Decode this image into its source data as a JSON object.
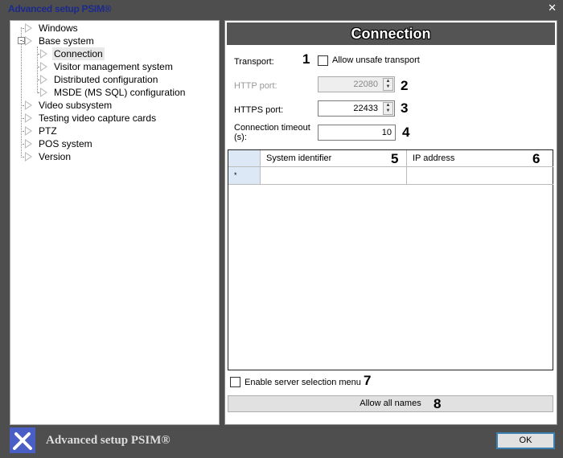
{
  "window": {
    "title": "Advanced setup PSIM®",
    "close": "✕"
  },
  "tree": {
    "items": [
      {
        "label": "Windows",
        "level": 0
      },
      {
        "label": "Base system",
        "level": 0,
        "expanded": true
      },
      {
        "label": "Connection",
        "level": 1,
        "selected": true
      },
      {
        "label": "Visitor management system",
        "level": 1
      },
      {
        "label": "Distributed configuration",
        "level": 1
      },
      {
        "label": "MSDE (MS SQL) configuration",
        "level": 1
      },
      {
        "label": "Video subsystem",
        "level": 0
      },
      {
        "label": "Testing video capture cards",
        "level": 0
      },
      {
        "label": "PTZ",
        "level": 0
      },
      {
        "label": "POS system",
        "level": 0
      },
      {
        "label": "Version",
        "level": 0
      }
    ]
  },
  "panel": {
    "title": "Connection",
    "transport_label": "Transport:",
    "allow_unsafe_label": "Allow unsafe transport",
    "allow_unsafe_checked": false,
    "http_label": "HTTP port:",
    "http_value": "22080",
    "https_label": "HTTPS port:",
    "https_value": "22433",
    "timeout_label": "Connection timeout (s):",
    "timeout_value": "10",
    "grid": {
      "columns": [
        "System identifier",
        "IP address"
      ],
      "new_row_marker": "*"
    },
    "enable_menu_label": "Enable server selection menu",
    "enable_menu_checked": false,
    "allow_all_label": "Allow all names"
  },
  "callouts": [
    "1",
    "2",
    "3",
    "4",
    "5",
    "6",
    "7",
    "8"
  ],
  "footer": {
    "app_name": "Advanced setup PSIM®",
    "ok_label": "OK"
  }
}
